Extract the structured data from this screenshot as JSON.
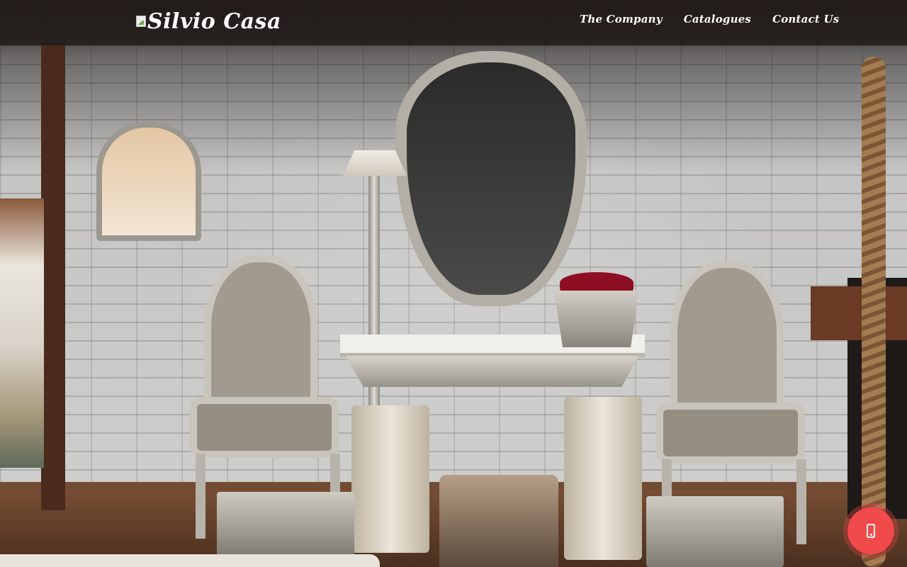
{
  "brand": {
    "name": "Silvio Casa"
  },
  "nav": {
    "items": [
      {
        "label": "The Company"
      },
      {
        "label": "Catalogues"
      },
      {
        "label": "Contact Us"
      }
    ]
  },
  "hero": {
    "image_subject": "showroom with silver-framed chairs, mirror and console table"
  },
  "fab": {
    "icon": "mobile-phone-icon",
    "color": "#f04a4a"
  },
  "colors": {
    "header_bg": "#221c1a",
    "text": "#ffffff",
    "accent": "#f04a4a"
  }
}
